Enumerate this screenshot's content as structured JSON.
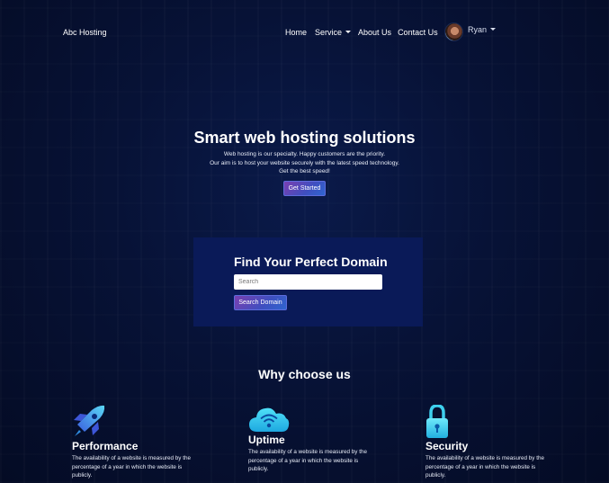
{
  "nav": {
    "brand": "Abc Hosting",
    "links": {
      "home": "Home",
      "service": "Service",
      "about": "About Us",
      "contact": "Contact Us"
    },
    "user_name": "Ryan"
  },
  "hero": {
    "title": "Smart web hosting solutions",
    "lines": [
      "Web hosting is our specialty. Happy customers are the priority.",
      "Our aim is to host your website securely with the latest speed technology.",
      "Get the best speed!"
    ],
    "cta": "Get Started"
  },
  "domain": {
    "title": "Find Your Perfect Domain",
    "placeholder": "Search",
    "button": "Search Domain"
  },
  "why": {
    "title": "Why choose us",
    "features": [
      {
        "title": "Performance",
        "icon": "rocket-icon",
        "text": "The availability of a website is measured by the percentage of a year in which the website is publicly."
      },
      {
        "title": "Uptime",
        "icon": "cloud-icon",
        "text": "The availability of a website is measured by the percentage of a year in which the website is publicly."
      },
      {
        "title": "Security",
        "icon": "padlock-icon",
        "text": "The availability of a website is measured by the percentage of a year in which the website is publicly."
      }
    ]
  },
  "colors": {
    "background": "#071236",
    "domain_panel": "#0a1a58",
    "button_gradient_start": "#7b3fb0",
    "button_gradient_end": "#2f66d0",
    "icon_cyan": "#3ed0ee"
  }
}
